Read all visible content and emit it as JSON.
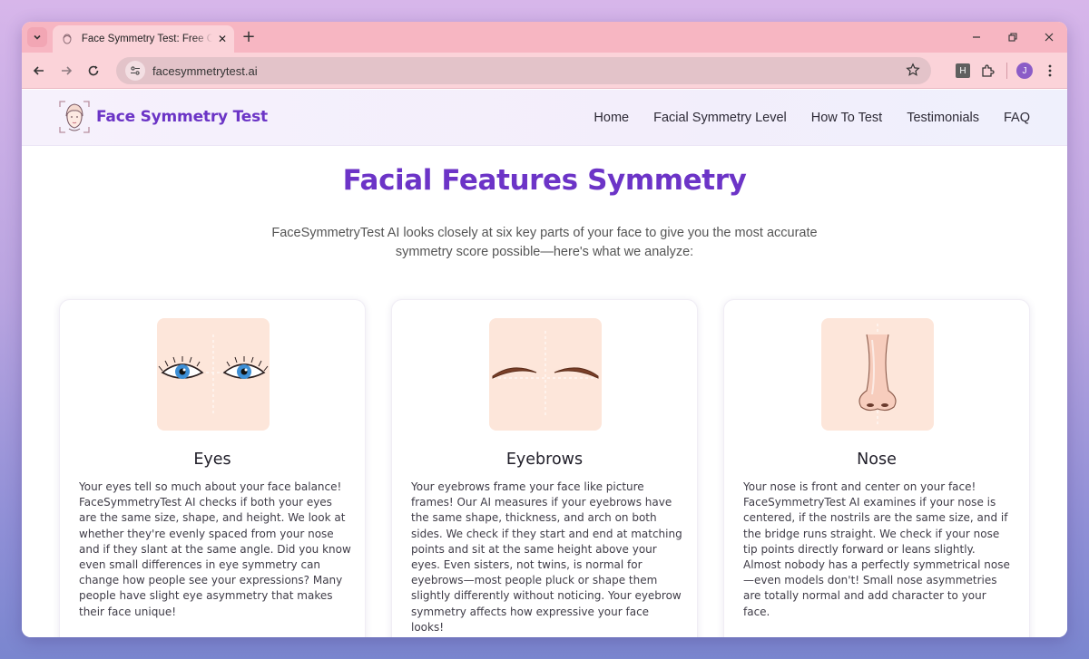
{
  "browser": {
    "tab_title": "Face Symmetry Test: Free Online",
    "url": "facesymmetrytest.ai",
    "extension_label": "H",
    "profile_initial": "J"
  },
  "site": {
    "logo_text": "Face Symmetry Test",
    "nav": [
      "Home",
      "Facial Symmetry Level",
      "How To Test",
      "Testimonials",
      "FAQ"
    ]
  },
  "section": {
    "title": "Facial Features Symmetry",
    "subtitle": "FaceSymmetryTest AI looks closely at six key parts of your face to give you the most accurate symmetry score possible—here's what we analyze:"
  },
  "cards": [
    {
      "title": "Eyes",
      "image": "eyes-illustration",
      "text": "Your eyes tell so much about your face balance! FaceSymmetryTest AI checks if both your eyes are the same size, shape, and height. We look at whether they're evenly spaced from your nose and if they slant at the same angle. Did you know even small differences in eye symmetry can change how people see your expressions? Many people have slight eye asymmetry that makes their face unique!"
    },
    {
      "title": "Eyebrows",
      "image": "eyebrows-illustration",
      "text": "Your eyebrows frame your face like picture frames! Our AI measures if your eyebrows have the same shape, thickness, and arch on both sides. We check if they start and end at matching points and sit at the same height above your eyes. Even sisters, not twins, is normal for eyebrows—most people pluck or shape them slightly differently without noticing. Your eyebrow symmetry affects how expressive your face looks!"
    },
    {
      "title": "Nose",
      "image": "nose-illustration",
      "text": "Your nose is front and center on your face! FaceSymmetryTest AI examines if your nose is centered, if the nostrils are the same size, and if the bridge runs straight. We check if your nose tip points directly forward or leans slightly. Almost nobody has a perfectly symmetrical nose—even models don't! Small nose asymmetries are totally normal and add character to your face."
    }
  ],
  "colors": {
    "brand_purple": "#6c34c7",
    "tab_strip": "#f7b6c2",
    "toolbar": "#fbd3d9",
    "card_image_bg": "#fde6da"
  }
}
